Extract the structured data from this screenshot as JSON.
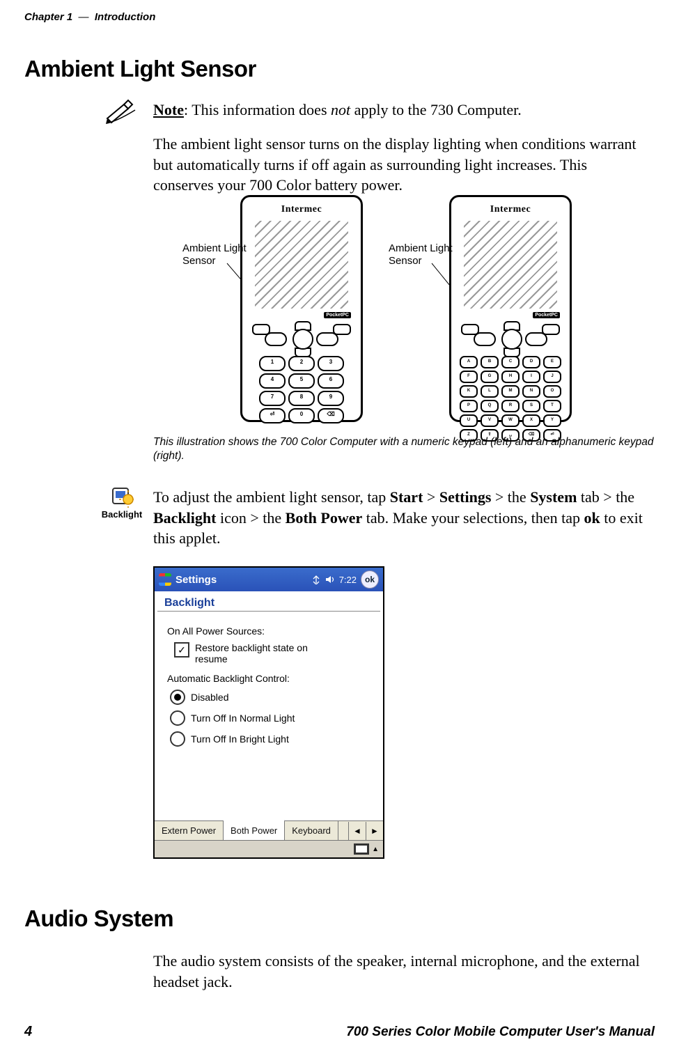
{
  "running_head": {
    "chapter": "Chapter 1",
    "dash": "—",
    "title": "Introduction"
  },
  "sections": {
    "ambient": "Ambient Light Sensor",
    "audio": "Audio System"
  },
  "note": {
    "label": "Note",
    "body": ": This information does ",
    "not_word": "not",
    "body2": " apply to the 730 Computer."
  },
  "paragraphs": {
    "p1": "The ambient light sensor turns on the display lighting when conditions warrant but automatically turns if off again as surrounding light increases. This conserves your 700 Color battery power.",
    "caption": "This illustration shows the 700 Color Computer with a numeric keypad (left) and an alphanumeric keypad (right).",
    "p2a": "To adjust the ambient light sensor, tap ",
    "start": "Start",
    "gt1": " > ",
    "settings": "Settings",
    "gt2": " > the ",
    "system": "System",
    "p2b": " tab > the ",
    "backlight": "Backlight",
    "p2c": " icon > the ",
    "bothpower": "Both Power",
    "p2d": " tab. Make your selections, then tap ",
    "ok": "ok",
    "p2e": " to exit this applet.",
    "p3": "The audio system consists of the speaker, internal microphone, and the external headset jack."
  },
  "figure": {
    "brand": "Intermec",
    "pocketpc": "PocketPC",
    "callout": "Ambient Light Sensor"
  },
  "icon_labels": {
    "backlight": "Backlight"
  },
  "screenshot": {
    "titlebar": {
      "app": "Settings",
      "time": "7:22",
      "ok": "ok"
    },
    "applet_title": "Backlight",
    "group1_label": "On All Power Sources:",
    "checkbox_label": "Restore backlight state on resume",
    "group2_label": "Automatic Backlight Control:",
    "radios": [
      {
        "label": "Disabled",
        "checked": true
      },
      {
        "label": "Turn Off In Normal Light",
        "checked": false
      },
      {
        "label": "Turn Off In Bright Light",
        "checked": false
      }
    ],
    "tabs": {
      "extern": "Extern Power",
      "both": "Both Power",
      "keyboard": "Keyboard"
    }
  },
  "footer": {
    "page": "4",
    "manual_title": "700 Series Color Mobile Computer User's Manual"
  }
}
